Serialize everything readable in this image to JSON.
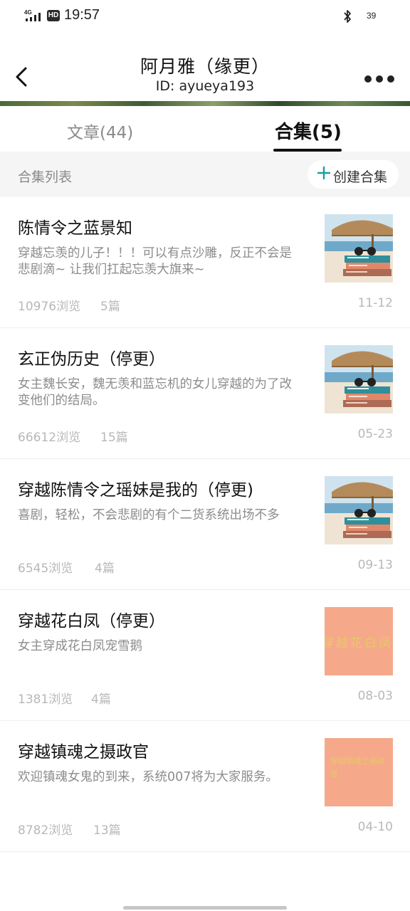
{
  "status_bar": {
    "network": "4G",
    "hd": "HD",
    "time": "19:57",
    "battery": "39"
  },
  "header": {
    "title": "阿月雅（缘更）",
    "subtitle": "ID: ayueya193"
  },
  "tabs": {
    "articles": "文章(44)",
    "collections": "合集(5)"
  },
  "section": {
    "title": "合集列表",
    "create_label": "创建合集"
  },
  "items": [
    {
      "title": "陈情令之蓝景知",
      "desc": "穿越忘羡的儿子！！！可以有点沙雕，反正不会是悲剧滴~ 让我们扛起忘羡大旗来~",
      "views": "10976浏览",
      "count": "5篇",
      "date": "11-12",
      "thumb": "beach-books"
    },
    {
      "title": "玄正伪历史（停更）",
      "desc": "女主魏长安，魏无羡和蓝忘机的女儿穿越的为了改变他们的结局。",
      "views": "66612浏览",
      "count": "15篇",
      "date": "05-23",
      "thumb": "beach-books"
    },
    {
      "title": "穿越陈情令之瑶妹是我的（停更)",
      "desc": "喜剧，轻松，不会悲剧的有个二货系统出场不多",
      "views": "6545浏览",
      "count": "4篇",
      "date": "09-13",
      "thumb": "beach-books"
    },
    {
      "title": "穿越花白凤（停更）",
      "desc": "女主穿成花白凤宠雪鹅",
      "views": "1381浏览",
      "count": "4篇",
      "date": "08-03",
      "thumb": "peach-text",
      "thumb_text": "穿越花白凤"
    },
    {
      "title": "穿越镇魂之摄政官",
      "desc": "欢迎镇魂女鬼的到来，系统007将为大家服务。",
      "views": "8782浏览",
      "count": "13篇",
      "date": "04-10",
      "thumb": "peach-text",
      "thumb_text": "穿越镇魂之摄政官"
    }
  ],
  "colors": {
    "accent_plus": "#17a0a0",
    "muted_text": "#8c8c8c",
    "meta_text": "#b8b8b8",
    "section_bg": "#f5f5f5",
    "thumb_peach": "#f6a98a"
  }
}
